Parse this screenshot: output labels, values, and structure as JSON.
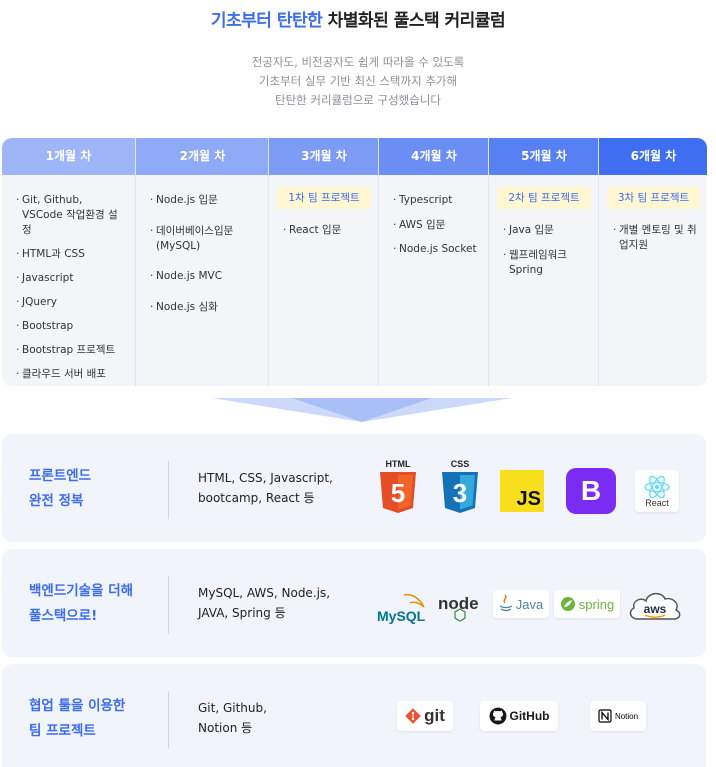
{
  "header": {
    "title_highlight": "기초부터 탄탄한",
    "title_rest": " 차별화된 풀스택 커리큘럼",
    "subtitle_lines": [
      "전공자도, 비전공자도 쉽게 따라올 수 있도록",
      "기초부터 실무 기반 최신 스택까지 추가해",
      "탄탄한 커리큘럼으로 구성했습니다"
    ]
  },
  "curriculum": [
    {
      "month": "1개월 차",
      "color": "#9eb6f7",
      "badge": "",
      "topics": [
        "Git, Github, VSCode 작업환경 설정",
        "HTML과 CSS",
        "Javascript",
        "JQuery",
        "Bootstrap",
        "Bootstrap 프로젝트",
        "클라우드 서버 배포"
      ]
    },
    {
      "month": "2개월 차",
      "color": "#8ea9f5",
      "badge": "",
      "topics": [
        "Node.js 입문",
        "데이버베이스입문 (MySQL)",
        "Node.js MVC",
        "Node.js 심화"
      ]
    },
    {
      "month": "3개월 차",
      "color": "#7c9bf4",
      "badge": "1차 팀 프로젝트",
      "topics": [
        "React 입문"
      ]
    },
    {
      "month": "4개월 차",
      "color": "#6a8ef4",
      "badge": "",
      "topics": [
        "Typescript",
        "AWS 입문",
        "Node.js Socket"
      ]
    },
    {
      "month": "5개월 차",
      "color": "#5780f3",
      "badge": "2차 팀 프로젝트",
      "topics": [
        "Java 입문",
        "웹프레임워크 Spring"
      ]
    },
    {
      "month": "6개월 차",
      "color": "#3f6ef2",
      "badge": "3차 팀 프로젝트",
      "topics": [
        "개별 멘토링 및 취업지원"
      ]
    }
  ],
  "cards": [
    {
      "title_lines": [
        "프론트엔드",
        "완전 정복"
      ],
      "desc_lines": [
        "HTML, CSS, Javascript,",
        "bootcamp, React 등"
      ],
      "logos": [
        {
          "icon": "html5-logo",
          "text": "HTML",
          "number": "5",
          "color": "#e44d26"
        },
        {
          "icon": "css3-logo",
          "text": "CSS",
          "number": "3",
          "color": "#1572b6"
        },
        {
          "icon": "js-logo",
          "text": "JS",
          "color": "#f7df1e"
        },
        {
          "icon": "bootstrap-logo",
          "text": "B",
          "color": "#7b2cf3"
        },
        {
          "icon": "react-logo",
          "text": "React",
          "color": "#61dafb"
        }
      ]
    },
    {
      "title_lines": [
        "백엔드기술을 더해",
        "풀스택으로!"
      ],
      "desc_lines": [
        "MySQL, AWS, Node.js,",
        "JAVA, Spring 등"
      ],
      "logos": [
        {
          "icon": "mysql-logo",
          "text": "MySQL",
          "color": "#00758f"
        },
        {
          "icon": "nodejs-logo",
          "text": "node",
          "color": "#3c873a"
        },
        {
          "icon": "java-logo",
          "text": "Java",
          "color": "#5382a1"
        },
        {
          "icon": "spring-logo",
          "text": "spring",
          "color": "#6db33f"
        },
        {
          "icon": "aws-logo",
          "text": "aws",
          "color": "#232f3e"
        }
      ]
    },
    {
      "title_lines": [
        "협업 툴을 이용한",
        "팀 프로젝트"
      ],
      "desc_lines": [
        "Git, Github,",
        "Notion 등"
      ],
      "logos": [
        {
          "icon": "git-logo",
          "text": "git",
          "color": "#f05133"
        },
        {
          "icon": "github-logo",
          "text": "GitHub",
          "color": "#181717"
        },
        {
          "icon": "notion-logo",
          "text": "Notion",
          "color": "#000000"
        }
      ]
    }
  ]
}
